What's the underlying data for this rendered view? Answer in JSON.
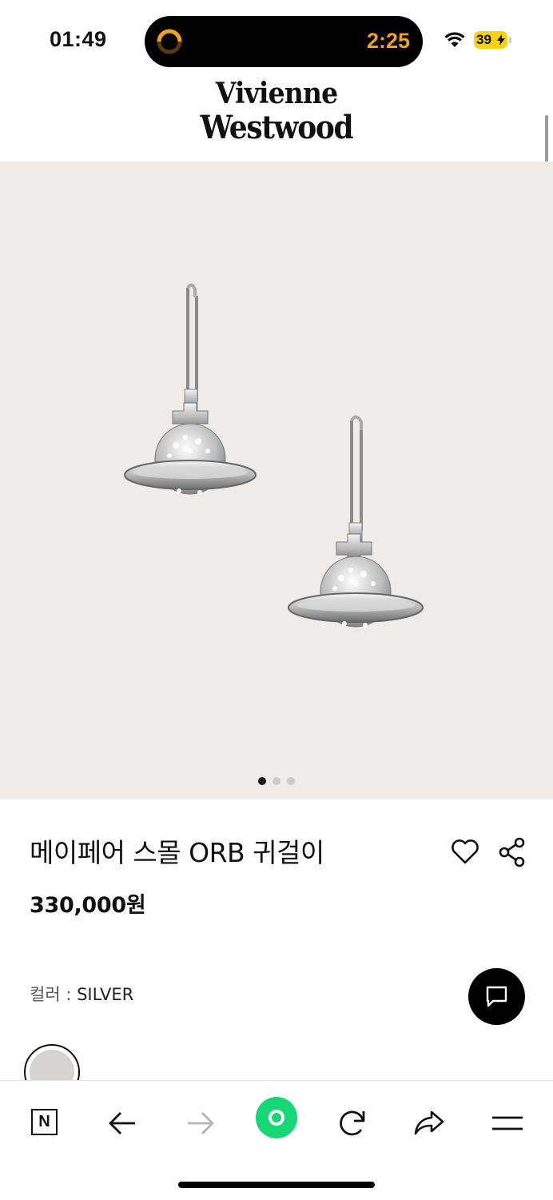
{
  "status_bar": {
    "time": "01:49",
    "timer": "2:25",
    "battery": "39"
  },
  "brand": {
    "line1": "Vivienne",
    "line2": "Westwood"
  },
  "gallery": {
    "image_alt": "Mayfair small ORB earrings",
    "pages": 3,
    "current_page": 1
  },
  "product": {
    "title": "메이페어 스몰 ORB 귀걸이",
    "price": "330,000원",
    "color_label": "컬러",
    "color_value": "SILVER"
  },
  "colors": {
    "hero_bg": "#efebe8",
    "accent_green": "#17d676",
    "timer_orange": "#f2a024",
    "battery_yellow": "#f8d117"
  },
  "bottom_nav": {
    "logo_letter": "N",
    "items": [
      "naver-home",
      "back",
      "forward",
      "green-dot",
      "reload",
      "share",
      "menu"
    ]
  }
}
